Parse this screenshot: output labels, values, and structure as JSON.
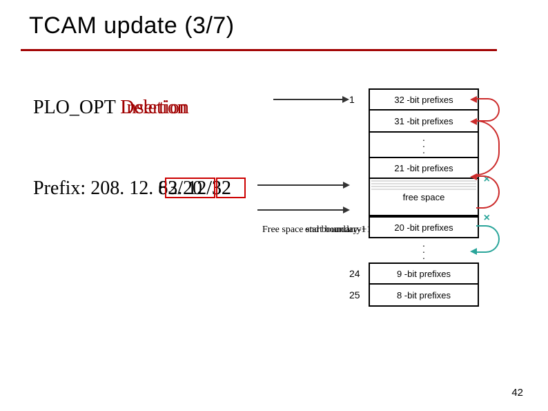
{
  "title": "TCAM update (3/7)",
  "plo": {
    "label": "PLO_OPT ",
    "word1": "Insertion",
    "word2": "Deletion"
  },
  "prefix": {
    "lead": "Prefix: 208. 12. ",
    "third_a": "82. 12",
    "third_b": "63/20",
    "slash_a": "/32",
    "slash_b": "/32"
  },
  "free_label": {
    "base": "Free space ",
    "overlay1": "start boundary",
    "overlay2": "end boundary",
    "tail": "+1",
    "tail2": "-1"
  },
  "rows": {
    "r1": {
      "num": "1",
      "label": "32 -bit prefixes"
    },
    "r2": {
      "num": "",
      "label": "31 -bit prefixes"
    },
    "r3": {
      "num": "",
      "label": "21 -bit prefixes"
    },
    "free": {
      "label": "free space"
    },
    "r4": {
      "num": "",
      "label": "20 -bit prefixes"
    },
    "r5": {
      "num": "24",
      "label": "9 -bit prefixes"
    },
    "r6": {
      "num": "25",
      "label": "8 -bit prefixes"
    }
  },
  "page": "42"
}
